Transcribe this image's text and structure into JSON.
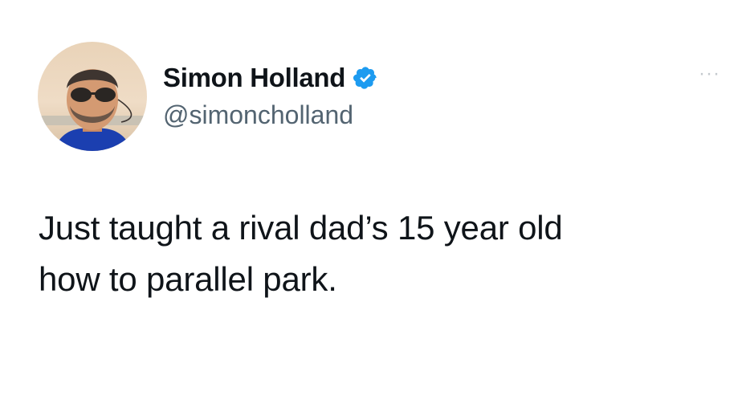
{
  "tweet": {
    "author": {
      "display_name": "Simon Holland",
      "handle": "@simoncholland",
      "verified": true
    },
    "text_line_1": "Just taught a rival dad’s 15 year old",
    "text_line_2": "how to parallel park.",
    "more_menu": "···"
  },
  "icons": {
    "verified": "verified-badge-icon",
    "more": "more-options-icon"
  },
  "colors": {
    "verified_blue": "#1d9bf0",
    "text_primary": "#0f1419",
    "text_secondary": "#536471"
  }
}
